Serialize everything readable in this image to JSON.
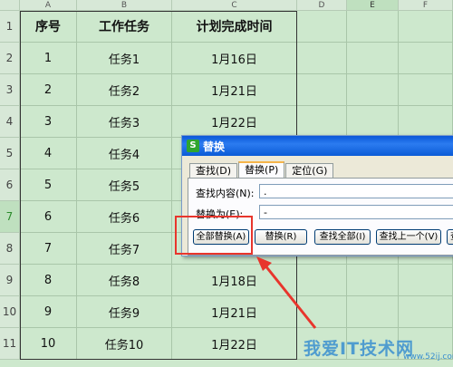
{
  "columns": [
    "A",
    "B",
    "C",
    "D",
    "E",
    "F"
  ],
  "selected_column": "E",
  "rows": [
    "1",
    "2",
    "3",
    "4",
    "5",
    "6",
    "7",
    "8",
    "9",
    "10",
    "11"
  ],
  "selected_row": "7",
  "table": {
    "headers": [
      "序号",
      "工作任务",
      "计划完成时间"
    ],
    "data": [
      [
        "1",
        "任务1",
        "1月16日"
      ],
      [
        "2",
        "任务2",
        "1月21日"
      ],
      [
        "3",
        "任务3",
        "1月22日"
      ],
      [
        "4",
        "任务4",
        ""
      ],
      [
        "5",
        "任务5",
        ""
      ],
      [
        "6",
        "任务6",
        ""
      ],
      [
        "7",
        "任务7",
        ""
      ],
      [
        "8",
        "任务8",
        "1月18日"
      ],
      [
        "9",
        "任务9",
        "1月21日"
      ],
      [
        "10",
        "任务10",
        "1月22日"
      ]
    ]
  },
  "dialog": {
    "title": "替换",
    "app_icon": "S",
    "tabs": [
      "查找(D)",
      "替换(P)",
      "定位(G)"
    ],
    "active_tab": 1,
    "find_label": "查找内容(N):",
    "find_value": ".",
    "replace_label": "替换为(E):",
    "replace_value": "-",
    "buttons": [
      "全部替换(A)",
      "替换(R)",
      "查找全部(I)",
      "查找上一个(V)",
      "查"
    ]
  },
  "watermark": "我爱IT技术网",
  "watermark_url": "www.52ij.com",
  "colors": {
    "highlight": "#e8352c",
    "titlebar": "#0a58d8",
    "grid": "#cde8cd"
  }
}
